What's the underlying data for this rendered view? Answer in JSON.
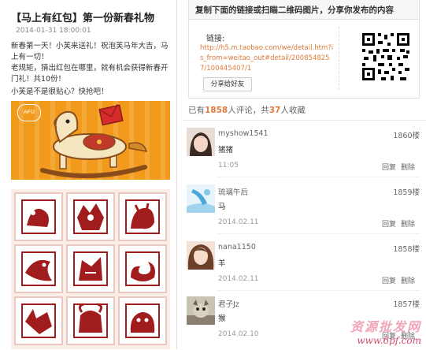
{
  "post": {
    "title": "【马上有红包】第一份新春礼物",
    "date": "2014-01-31 18:00:01",
    "para1": "新春第一天！小芙来送礼！祝泡芙马年大吉，马上有一切！",
    "para2": "老规矩，猜出红包在哪里，就有机会获得新春开门礼！共10份！",
    "para3": "小芙是不是很贴心？快抢吧！",
    "banner_badge": "AFU"
  },
  "share": {
    "heading": "复制下面的链接或扫瞄二维码图片，分享你发布的内容",
    "link_label": "链接:",
    "link_url": "http://h5.m.taobao.com/we/detail.htm?is_from=weitao_out#detail/2008548257/100445407/1",
    "share_button": "分享给好友"
  },
  "stats": {
    "prefix": "已有",
    "comments": "1858",
    "mid": "人评论，共",
    "favorites": "37",
    "suffix": "人收藏"
  },
  "comments": [
    {
      "user": "myshow1541",
      "floor": "1860楼",
      "text": "猪猪",
      "time": "11:05",
      "reply": "回复",
      "delete": "删除"
    },
    {
      "user": "琉璃午后",
      "floor": "1859楼",
      "text": "马",
      "time": "2014.02.11",
      "reply": "回复",
      "delete": "删除"
    },
    {
      "user": "nana1150",
      "floor": "1858楼",
      "text": "羊",
      "time": "2014.02.11",
      "reply": "回复",
      "delete": "删除"
    },
    {
      "user": "君子Jz",
      "floor": "1857楼",
      "text": "猴",
      "time": "2014.02.10",
      "reply": "回复",
      "delete": "删除"
    }
  ],
  "watermark": {
    "text": "资源批发网",
    "url": "www.6pf.com"
  },
  "colors": {
    "accent": "#e07a3a",
    "banner": "#f29a1c",
    "stamp_red": "#a11c1c"
  }
}
